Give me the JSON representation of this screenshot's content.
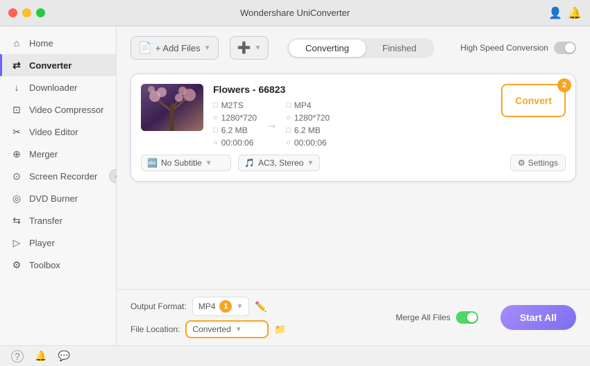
{
  "app": {
    "title": "Wondershare UniConverter"
  },
  "titlebar": {
    "buttons": {
      "close": "close",
      "minimize": "minimize",
      "maximize": "maximize"
    }
  },
  "sidebar": {
    "items": [
      {
        "id": "home",
        "label": "Home",
        "icon": "⌂",
        "active": false
      },
      {
        "id": "converter",
        "label": "Converter",
        "icon": "⇄",
        "active": true
      },
      {
        "id": "downloader",
        "label": "Downloader",
        "icon": "↓",
        "active": false
      },
      {
        "id": "video-compressor",
        "label": "Video Compressor",
        "icon": "⊡",
        "active": false
      },
      {
        "id": "video-editor",
        "label": "Video Editor",
        "icon": "✂",
        "active": false
      },
      {
        "id": "merger",
        "label": "Merger",
        "icon": "⊕",
        "active": false
      },
      {
        "id": "screen-recorder",
        "label": "Screen Recorder",
        "icon": "⊙",
        "active": false
      },
      {
        "id": "dvd-burner",
        "label": "DVD Burner",
        "icon": "◎",
        "active": false
      },
      {
        "id": "transfer",
        "label": "Transfer",
        "icon": "⇆",
        "active": false
      },
      {
        "id": "player",
        "label": "Player",
        "icon": "▷",
        "active": false
      },
      {
        "id": "toolbox",
        "label": "Toolbox",
        "icon": "⚙",
        "active": false
      }
    ]
  },
  "toolbar": {
    "add_files_label": "+ Add Files",
    "add_more_label": "Add More",
    "tabs": [
      {
        "id": "converting",
        "label": "Converting",
        "active": true
      },
      {
        "id": "finished",
        "label": "Finished",
        "active": false
      }
    ],
    "high_speed_label": "High Speed Conversion"
  },
  "file_card": {
    "filename": "Flowers - 66823",
    "source": {
      "format": "M2TS",
      "resolution": "1280*720",
      "size": "6.2 MB",
      "duration": "00:00:06"
    },
    "target": {
      "format": "MP4",
      "resolution": "1280*720",
      "size": "6.2 MB",
      "duration": "00:00:06"
    },
    "subtitle": "No Subtitle",
    "audio": "AC3, Stereo",
    "settings_label": "Settings",
    "convert_label": "Convert",
    "convert_badge": "2"
  },
  "bottom_bar": {
    "output_format_label": "Output Format:",
    "output_format_value": "MP4",
    "badge_num": "1",
    "file_location_label": "File Location:",
    "file_location_value": "Converted",
    "merge_label": "Merge All Files",
    "start_all_label": "Start All"
  },
  "status_bar": {
    "help_icon": "?",
    "bell_icon": "🔔",
    "chat_icon": "💬"
  }
}
